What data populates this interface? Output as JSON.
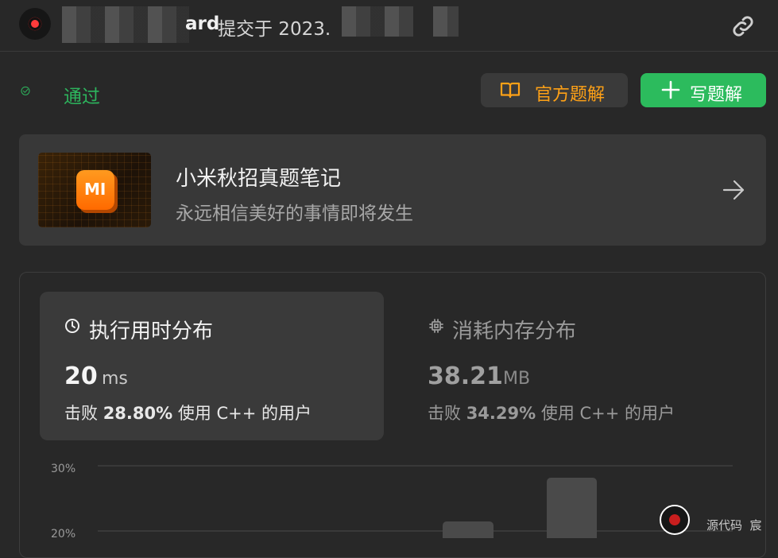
{
  "header": {
    "user_suffix": "ard",
    "submitted_text": "提交于 2023."
  },
  "status": {
    "text": "通过",
    "color": "#2db55d"
  },
  "buttons": {
    "official": {
      "label": "官方题解",
      "color": "#ffa116"
    },
    "write": {
      "label": "写题解",
      "color": "#2cbb5d"
    }
  },
  "promo": {
    "logo_text": "MI",
    "title": "小米秋招真题笔记",
    "subtitle": "永远相信美好的事情即将发生"
  },
  "runtime": {
    "title": "执行用时分布",
    "value": "20",
    "unit": "ms",
    "beat_prefix": "击败",
    "beat_percent": "28.80%",
    "beat_suffix": "使用 C++ 的用户"
  },
  "memory": {
    "title": "消耗内存分布",
    "value": "38.21",
    "unit": "MB",
    "beat_prefix": "击败",
    "beat_percent": "34.29%",
    "beat_suffix": "使用 C++ 的用户"
  },
  "chart_data": {
    "type": "bar",
    "yticks": [
      "30%",
      "20%"
    ],
    "note": "partial view; bars visible but values cut off"
  },
  "footer": {
    "text": "源代码  宸"
  }
}
